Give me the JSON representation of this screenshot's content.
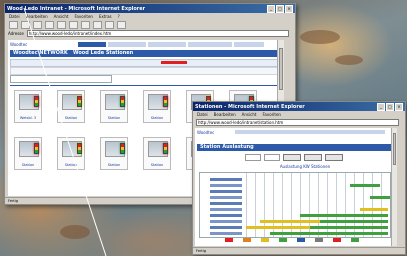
{
  "main_window": {
    "title": "Wood Ledo Intranet - Microsoft Internet Explorer",
    "menu": [
      "Datei",
      "Bearbeiten",
      "Ansicht",
      "Favoriten",
      "Extras",
      "?"
    ],
    "address_label": "Adresse",
    "address_value": "http://www.wood-ledo/intranet/index.htm",
    "go_label": "Wechseln zu",
    "nav_tabs": [
      "Links"
    ],
    "header": "Woodtec NETWORK",
    "sub_header": "Wood Lede Stationen",
    "stations": [
      {
        "label": "Wetsbl. 3",
        "light": "red"
      },
      {
        "label": "Station",
        "light": "yellow"
      },
      {
        "label": "Station",
        "light": "green"
      },
      {
        "label": "Station",
        "light": "red"
      },
      {
        "label": "Station",
        "light": "yellow"
      },
      {
        "label": "Station",
        "light": "green"
      },
      {
        "label": "Station",
        "light": "red"
      },
      {
        "label": "Station",
        "light": "yellow"
      },
      {
        "label": "Station",
        "light": "green"
      },
      {
        "label": "Station",
        "light": "red"
      },
      {
        "label": "Station",
        "light": "yellow"
      },
      {
        "label": "Station",
        "light": "green"
      }
    ],
    "status_text": "Fertig"
  },
  "second_window": {
    "title": "Stationen - Microsoft Internet Explorer",
    "menu": [
      "Datei",
      "Bearbeiten",
      "Ansicht",
      "Favoriten",
      "Extras",
      "?"
    ],
    "address_value": "http://www.wood-ledo/intranet/station.htm",
    "header": "Station Auslastung",
    "chart_title": "Auslastung KW Stationen",
    "status_text": "Fertig"
  },
  "colors": {
    "titlebar": "#0a246a",
    "header_blue": "#2d5aa8",
    "accent_red": "#e02020",
    "accent_green": "#40a040",
    "accent_yellow": "#e0c020"
  }
}
